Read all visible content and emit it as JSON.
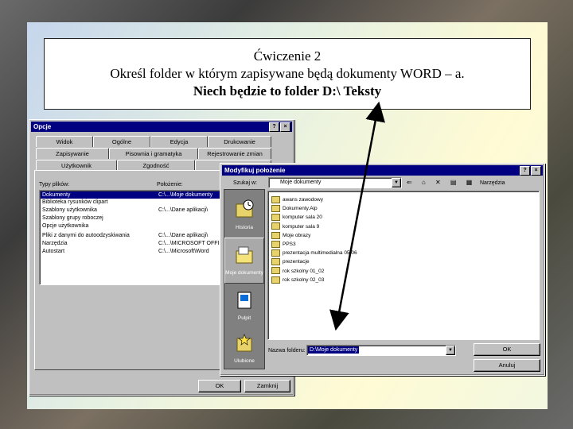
{
  "banner": {
    "line1": "Ćwiczenie 2",
    "line2": "Określ folder w którym zapisywane będą dokumenty WORD – a.",
    "line3": "Niech będzie to folder D:\\ Teksty"
  },
  "options_dialog": {
    "title": "Opcje",
    "help_button": "?",
    "close_button": "×",
    "tabs_row1": [
      "Widok",
      "Ogólne",
      "Edycja",
      "Drukowanie"
    ],
    "tabs_row2": [
      "Zapisywanie",
      "Pisownia i gramatyka",
      "Rejestrowanie zmian"
    ],
    "tabs_row3": [
      "Użytkownik",
      "Zgodność",
      "Położenie plików"
    ],
    "col_types": "Typy plików:",
    "col_location": "Położenie:",
    "file_types": [
      {
        "type": "Dokumenty",
        "location": "C:\\...\\Moje dokumenty"
      },
      {
        "type": "Biblioteka rysunków clipart",
        "location": ""
      },
      {
        "type": "Szablony użytkownika",
        "location": "C:\\...\\Dane aplikacji\\"
      },
      {
        "type": "Szablony grupy roboczej",
        "location": ""
      },
      {
        "type": "Opcje użytkownika",
        "location": ""
      },
      {
        "type": "Pliki z danymi do autoodzyskiwania",
        "location": "C:\\...\\Dane aplikacji\\"
      },
      {
        "type": "Narzędzia",
        "location": "C:\\...\\MICROSOFT OFFICE"
      },
      {
        "type": "Autostart",
        "location": "C:\\...\\Microsoft\\Word"
      }
    ],
    "ok_button": "OK",
    "close_label": "Zamknij"
  },
  "modify_dialog": {
    "title": "Modyfikuj położenie",
    "help_button": "?",
    "close_button": "×",
    "lookin_label": "Szukaj w:",
    "lookin_value": "Moje dokumenty",
    "tools_label": "Narzędzia",
    "sidebar": [
      "Historia",
      "Moje dokumenty",
      "Pulpit",
      "Ulubione"
    ],
    "folders": [
      "awans zawodowy",
      "Dokumenty.Aip",
      "komputer sala 20",
      "komputer sala 9",
      "Moje obrazy",
      "PPS3",
      "prezentacja multimedialna 05/06",
      "prezentacje",
      "rok szkolny 01_02",
      "rok szkolny 02_03"
    ],
    "name_label": "Nazwa folderu:",
    "name_value": "D:\\Moje dokumenty",
    "ok_button": "OK",
    "cancel_button": "Anuluj"
  }
}
